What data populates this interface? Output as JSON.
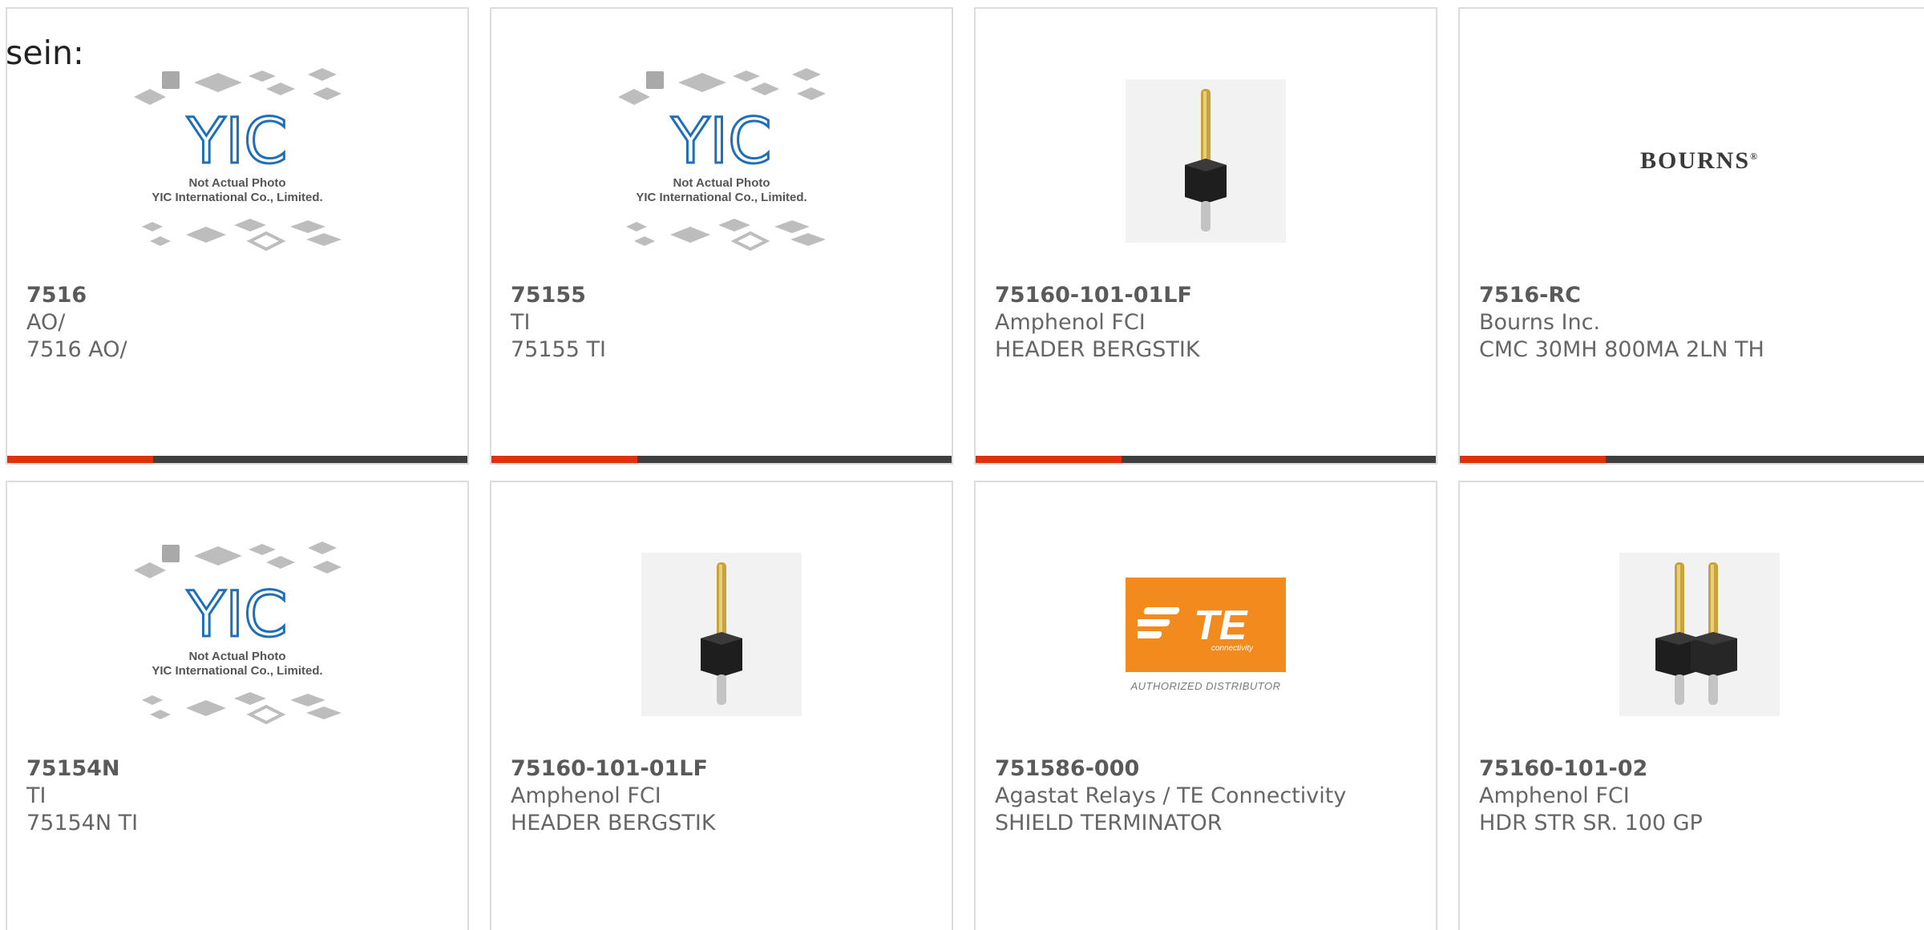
{
  "intro_text": "sein:",
  "placeholder": {
    "logo": "YIC",
    "line1": "Not Actual Photo",
    "line2": "YIC International Co., Limited."
  },
  "products": [
    {
      "part": "7516",
      "manufacturer": "AO/",
      "description": "7516 AO/",
      "image": "yic-placeholder"
    },
    {
      "part": "75155",
      "manufacturer": "TI",
      "description": "75155 TI",
      "image": "yic-placeholder"
    },
    {
      "part": "75160-101-01LF",
      "manufacturer": "Amphenol FCI",
      "description": "HEADER BERGSTIK",
      "image": "single-pin-header"
    },
    {
      "part": "7516-RC",
      "manufacturer": "Bourns Inc.",
      "description": "CMC 30MH 800MA 2LN TH",
      "image": "bourns-logo"
    },
    {
      "part": "75154N",
      "manufacturer": "TI",
      "description": "75154N TI",
      "image": "yic-placeholder"
    },
    {
      "part": "75160-101-01LF",
      "manufacturer": "Amphenol FCI",
      "description": "HEADER BERGSTIK",
      "image": "single-pin-header"
    },
    {
      "part": "751586-000",
      "manufacturer": "Agastat Relays / TE Connectivity",
      "description": "SHIELD TERMINATOR",
      "image": "te-logo"
    },
    {
      "part": "75160-101-02",
      "manufacturer": "Amphenol FCI",
      "description": "HDR STR SR. 100 GP",
      "image": "double-pin-header"
    }
  ],
  "logos": {
    "bourns": "BOURNS",
    "bourns_mark": "®",
    "te": "TE",
    "te_sub": "connectivity",
    "te_caption": "AUTHORIZED DISTRIBUTOR"
  },
  "colors": {
    "accent": "#e0300c",
    "bar": "#3f3f3f",
    "yic_blue": "#1f6fb8",
    "te_orange": "#f28a1e"
  }
}
